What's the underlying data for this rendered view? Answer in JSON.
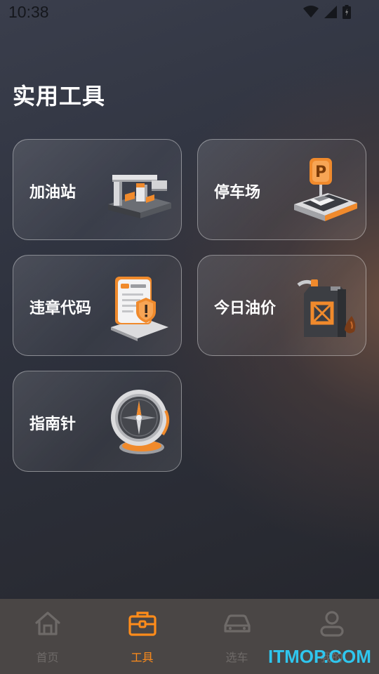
{
  "status_bar": {
    "time": "10:38"
  },
  "page": {
    "title": "实用工具"
  },
  "tools": [
    {
      "label": "加油站",
      "icon": "gas-station-icon"
    },
    {
      "label": "停车场",
      "icon": "parking-icon"
    },
    {
      "label": "违章代码",
      "icon": "violation-document-icon"
    },
    {
      "label": "今日油价",
      "icon": "fuel-can-icon"
    },
    {
      "label": "指南针",
      "icon": "compass-icon"
    }
  ],
  "tab_bar": {
    "items": [
      {
        "label": "首页",
        "icon": "home-icon",
        "active": false
      },
      {
        "label": "工具",
        "icon": "toolbox-icon",
        "active": true
      },
      {
        "label": "选车",
        "icon": "car-icon",
        "active": false
      },
      {
        "label": "我的",
        "icon": "user-icon",
        "active": false
      }
    ]
  },
  "watermark": "ITMOP.COM",
  "colors": {
    "accent": "#ff8c1a",
    "tab_bar_bg": "#4a4645",
    "inactive_tab": "#6e6a68",
    "watermark": "#2fc6ee"
  }
}
